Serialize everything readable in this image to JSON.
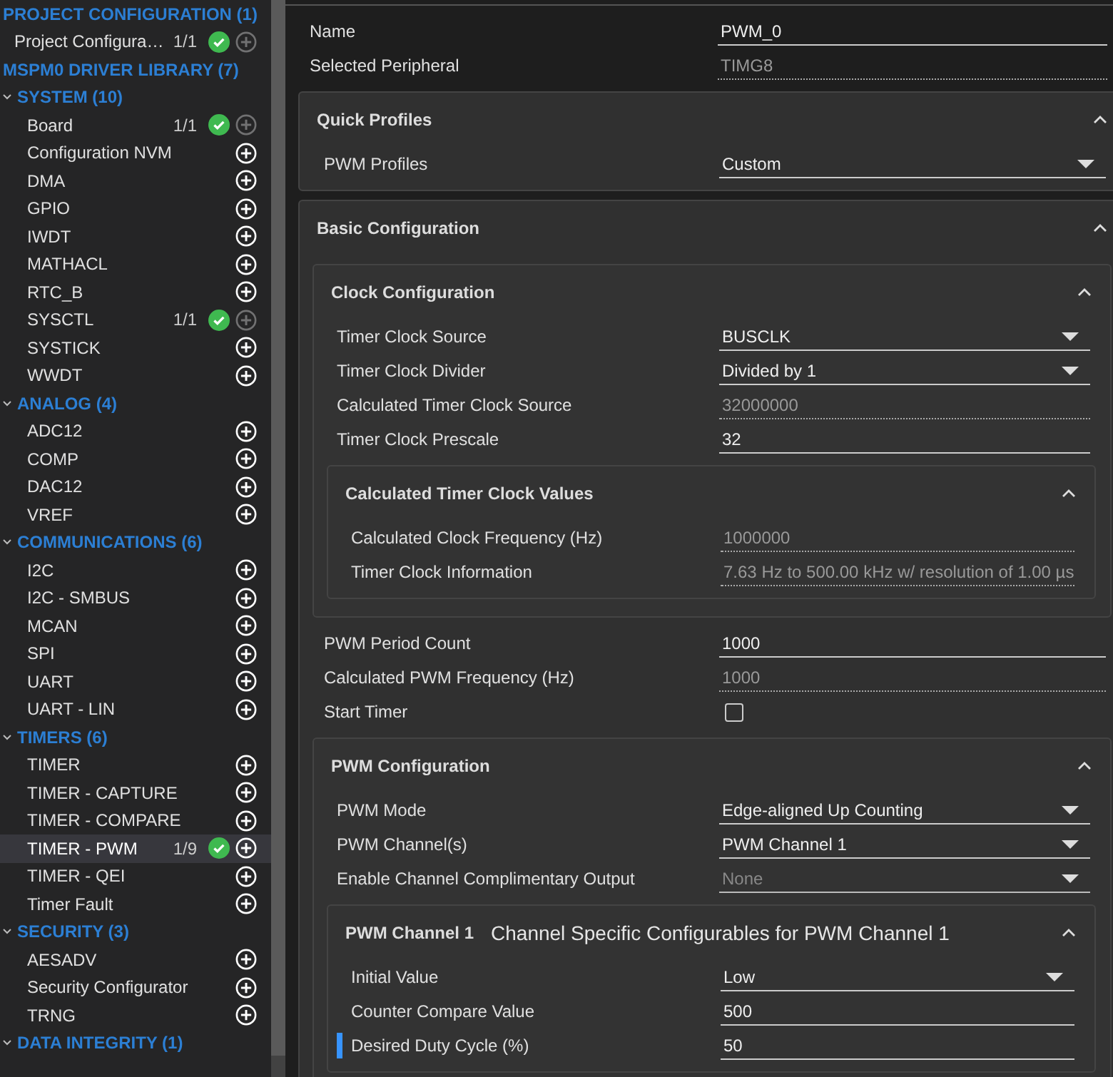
{
  "sidebar": {
    "sections": [
      {
        "title": "PROJECT CONFIGURATION (1)",
        "children": [
          {
            "kind": "module",
            "label": "Project Configura…",
            "count": "1/1",
            "add_enabled": false,
            "selected": false
          }
        ]
      },
      {
        "title": "MSPM0 DRIVER LIBRARY (7)",
        "children": [
          {
            "kind": "category",
            "label": "SYSTEM (10)",
            "expanded": true,
            "children": [
              {
                "kind": "module",
                "label": "Board",
                "count": "1/1",
                "add_enabled": false,
                "selected": false
              },
              {
                "kind": "module",
                "label": "Configuration NVM",
                "add_enabled": true,
                "selected": false
              },
              {
                "kind": "module",
                "label": "DMA",
                "add_enabled": true,
                "selected": false
              },
              {
                "kind": "module",
                "label": "GPIO",
                "add_enabled": true,
                "selected": false
              },
              {
                "kind": "module",
                "label": "IWDT",
                "add_enabled": true,
                "selected": false
              },
              {
                "kind": "module",
                "label": "MATHACL",
                "add_enabled": true,
                "selected": false
              },
              {
                "kind": "module",
                "label": "RTC_B",
                "add_enabled": true,
                "selected": false
              },
              {
                "kind": "module",
                "label": "SYSCTL",
                "count": "1/1",
                "add_enabled": false,
                "selected": false
              },
              {
                "kind": "module",
                "label": "SYSTICK",
                "add_enabled": true,
                "selected": false
              },
              {
                "kind": "module",
                "label": "WWDT",
                "add_enabled": true,
                "selected": false
              }
            ]
          },
          {
            "kind": "category",
            "label": "ANALOG (4)",
            "expanded": true,
            "children": [
              {
                "kind": "module",
                "label": "ADC12",
                "add_enabled": true,
                "selected": false
              },
              {
                "kind": "module",
                "label": "COMP",
                "add_enabled": true,
                "selected": false
              },
              {
                "kind": "module",
                "label": "DAC12",
                "add_enabled": true,
                "selected": false
              },
              {
                "kind": "module",
                "label": "VREF",
                "add_enabled": true,
                "selected": false
              }
            ]
          },
          {
            "kind": "category",
            "label": "COMMUNICATIONS (6)",
            "expanded": true,
            "children": [
              {
                "kind": "module",
                "label": "I2C",
                "add_enabled": true,
                "selected": false
              },
              {
                "kind": "module",
                "label": "I2C - SMBUS",
                "add_enabled": true,
                "selected": false
              },
              {
                "kind": "module",
                "label": "MCAN",
                "add_enabled": true,
                "selected": false
              },
              {
                "kind": "module",
                "label": "SPI",
                "add_enabled": true,
                "selected": false
              },
              {
                "kind": "module",
                "label": "UART",
                "add_enabled": true,
                "selected": false
              },
              {
                "kind": "module",
                "label": "UART - LIN",
                "add_enabled": true,
                "selected": false
              }
            ]
          },
          {
            "kind": "category",
            "label": "TIMERS (6)",
            "expanded": true,
            "children": [
              {
                "kind": "module",
                "label": "TIMER",
                "add_enabled": true,
                "selected": false
              },
              {
                "kind": "module",
                "label": "TIMER - CAPTURE",
                "add_enabled": true,
                "selected": false
              },
              {
                "kind": "module",
                "label": "TIMER - COMPARE",
                "add_enabled": true,
                "selected": false
              },
              {
                "kind": "module",
                "label": "TIMER - PWM",
                "count": "1/9",
                "add_enabled": true,
                "selected": true
              },
              {
                "kind": "module",
                "label": "TIMER - QEI",
                "add_enabled": true,
                "selected": false
              },
              {
                "kind": "module",
                "label": "Timer Fault",
                "add_enabled": true,
                "selected": false
              }
            ]
          },
          {
            "kind": "category",
            "label": "SECURITY (3)",
            "expanded": true,
            "children": [
              {
                "kind": "module",
                "label": "AESADV",
                "add_enabled": true,
                "selected": false
              },
              {
                "kind": "module",
                "label": "Security Configurator",
                "add_enabled": true,
                "selected": false
              },
              {
                "kind": "module",
                "label": "TRNG",
                "add_enabled": true,
                "selected": false
              }
            ]
          },
          {
            "kind": "category",
            "label": "DATA INTEGRITY (1)",
            "expanded": true
          }
        ]
      }
    ]
  },
  "form": {
    "items": [
      {
        "kind": "text",
        "label": "Name",
        "value": "PWM_0",
        "highlighted": false
      },
      {
        "kind": "readonly",
        "label": "Selected Peripheral",
        "value": "TIMG8",
        "highlighted": false
      },
      {
        "kind": "section",
        "title": "Quick Profiles",
        "expanded": true,
        "items": [
          {
            "kind": "select",
            "label": "PWM Profiles",
            "value": "Custom",
            "disabled": false,
            "highlighted": false
          }
        ]
      },
      {
        "kind": "section",
        "title": "Basic Configuration",
        "expanded": true,
        "items": [
          {
            "kind": "section",
            "title": "Clock Configuration",
            "expanded": true,
            "items": [
              {
                "kind": "select",
                "label": "Timer Clock Source",
                "value": "BUSCLK",
                "disabled": false,
                "highlighted": false
              },
              {
                "kind": "select",
                "label": "Timer Clock Divider",
                "value": "Divided by 1",
                "disabled": false,
                "highlighted": false
              },
              {
                "kind": "readonly",
                "label": "Calculated Timer Clock Source",
                "value": "32000000",
                "highlighted": false
              },
              {
                "kind": "text",
                "label": "Timer Clock Prescale",
                "value": "32",
                "highlighted": false
              },
              {
                "kind": "section",
                "title": "Calculated Timer Clock Values",
                "expanded": true,
                "items": [
                  {
                    "kind": "readonly",
                    "label": "Calculated Clock Frequency (Hz)",
                    "value": "1000000",
                    "highlighted": false
                  },
                  {
                    "kind": "readonly",
                    "label": "Timer Clock Information",
                    "value": "7.63 Hz to 500.00 kHz w/ resolution of 1.00 µs",
                    "highlighted": false
                  }
                ]
              }
            ]
          },
          {
            "kind": "text",
            "label": "PWM Period Count",
            "value": "1000",
            "highlighted": false
          },
          {
            "kind": "readonly",
            "label": "Calculated PWM Frequency (Hz)",
            "value": "1000",
            "highlighted": false
          },
          {
            "kind": "checkbox",
            "label": "Start Timer",
            "checked": false,
            "highlighted": false
          },
          {
            "kind": "section",
            "title": "PWM Configuration",
            "expanded": true,
            "items": [
              {
                "kind": "select",
                "label": "PWM Mode",
                "value": "Edge-aligned Up Counting",
                "disabled": false,
                "highlighted": false
              },
              {
                "kind": "select",
                "label": "PWM Channel(s)",
                "value": "PWM Channel 1",
                "disabled": false,
                "highlighted": false
              },
              {
                "kind": "select",
                "label": "Enable Channel Complimentary Output",
                "value": "None",
                "disabled": true,
                "highlighted": false
              },
              {
                "kind": "section",
                "title": "PWM Channel 1",
                "subtitle": "Channel Specific Configurables for PWM Channel 1",
                "expanded": true,
                "items": [
                  {
                    "kind": "select",
                    "label": "Initial Value",
                    "value": "Low",
                    "disabled": false,
                    "highlighted": false
                  },
                  {
                    "kind": "text",
                    "label": "Counter Compare Value",
                    "value": "500",
                    "highlighted": false
                  },
                  {
                    "kind": "text",
                    "label": "Desired Duty Cycle (%)",
                    "value": "50",
                    "highlighted": true
                  }
                ]
              }
            ]
          }
        ]
      }
    ]
  }
}
